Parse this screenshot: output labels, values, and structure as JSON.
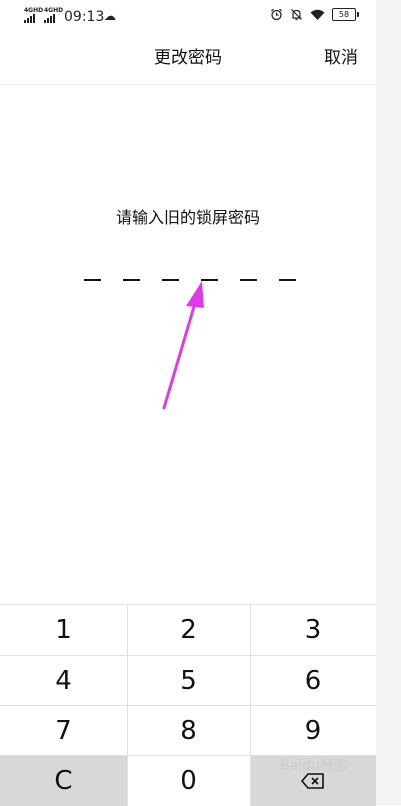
{
  "status_bar": {
    "signal1": "4G",
    "signal2": "4G",
    "hd_mark": "HD",
    "time": "09:13",
    "weather_icon": "cloud-icon",
    "alarm_icon": "alarm-icon",
    "mute_icon": "bell-off-icon",
    "wifi_icon": "wifi-icon",
    "battery_level": "58"
  },
  "header": {
    "title": "更改密码",
    "cancel_label": "取消"
  },
  "prompt": {
    "text": "请输入旧的锁屏密码",
    "pin_length": 6
  },
  "keypad": {
    "rows": [
      [
        "1",
        "2",
        "3"
      ],
      [
        "4",
        "5",
        "6"
      ],
      [
        "7",
        "8",
        "9"
      ],
      [
        "C",
        "0",
        "delete"
      ]
    ],
    "clear_label": "C",
    "zero_label": "0",
    "delete_icon": "backspace-icon"
  },
  "annotation": {
    "arrow_color": "#e03ae8"
  },
  "watermark": "Baidu经验"
}
